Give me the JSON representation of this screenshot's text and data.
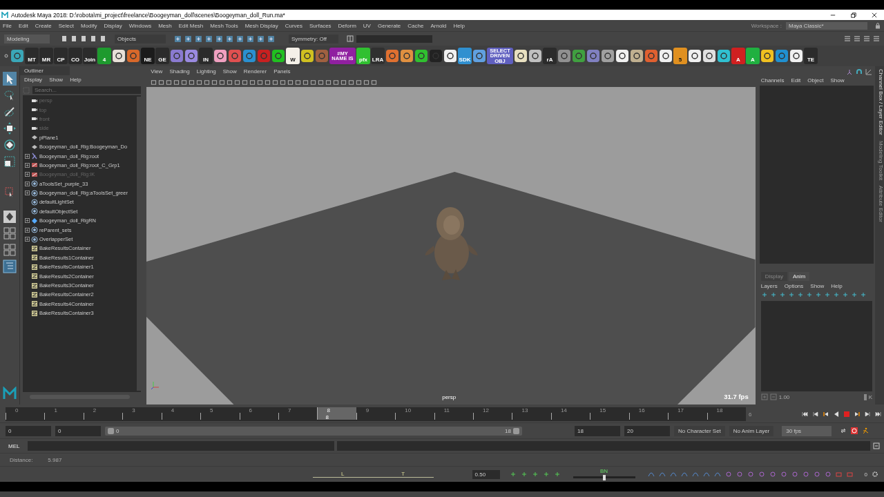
{
  "window": {
    "title": "Autodesk Maya 2018: D:\\robota\\mi_project\\freelance\\Boogeyman_doll\\scenes\\Boogeyman_doll_Run.ma*"
  },
  "menu": [
    "File",
    "Edit",
    "Create",
    "Select",
    "Modify",
    "Display",
    "Windows",
    "Mesh",
    "Edit Mesh",
    "Mesh Tools",
    "Mesh Display",
    "Curves",
    "Surfaces",
    "Deform",
    "UV",
    "Generate",
    "Cache",
    "Arnold",
    "Help"
  ],
  "workspace": {
    "label": "Workspace :",
    "value": "Maya Classic*"
  },
  "status_line": {
    "mode": "Modeling",
    "selection": "Objects",
    "symmetry": "Symmetry: Off"
  },
  "shelf": [
    {
      "color": "#3aa7b8"
    },
    {
      "label": "MT",
      "color": "#2b2b2b"
    },
    {
      "label": "MR",
      "color": "#2b2b2b"
    },
    {
      "label": "CP",
      "color": "#2b2b2b"
    },
    {
      "label": "CO",
      "color": "#2b2b2b"
    },
    {
      "label": "Join",
      "color": "#2b2b2b"
    },
    {
      "label": "4",
      "color": "#1e9a2e"
    },
    {
      "color": "#e8e0d8"
    },
    {
      "color": "#d8682a"
    },
    {
      "label": "NE",
      "color": "#1b1b1b"
    },
    {
      "label": "GE",
      "color": "#2b2b2b"
    },
    {
      "color": "#8a7ad0"
    },
    {
      "color": "#9a8ae0"
    },
    {
      "label": "IN",
      "color": "#2b2b2b"
    },
    {
      "color": "#f0a0c0"
    },
    {
      "color": "#e05050"
    },
    {
      "color": "#2a90d0"
    },
    {
      "color": "#c82020"
    },
    {
      "color": "#20c020"
    },
    {
      "label": "W",
      "color": "#f4f0e8"
    },
    {
      "color": "#d0c020"
    },
    {
      "color": "#a06040"
    },
    {
      "label": "#MY NAME IS",
      "color": "#9020a0"
    },
    {
      "label": "pfx",
      "color": "#30c030"
    },
    {
      "label": "LRA",
      "color": "#303030"
    },
    {
      "color": "#e07030"
    },
    {
      "color": "#e09040"
    },
    {
      "color": "#30c030"
    },
    {
      "color": "#222222"
    },
    {
      "color": "#f0f0f0"
    },
    {
      "label": "SDK",
      "color": "#3090d0"
    },
    {
      "color": "#60a0e0"
    },
    {
      "label": "SELECT DRIVEN OBJ",
      "color": "#6060c0"
    },
    {
      "color": "#e8e0c0"
    },
    {
      "color": "#c0c0c0"
    },
    {
      "label": "rA",
      "color": "#2b2b2b"
    },
    {
      "color": "#909090"
    },
    {
      "color": "#40a040"
    },
    {
      "color": "#8080c0"
    },
    {
      "color": "#a0a0a0"
    },
    {
      "color": "#f0f0f0"
    },
    {
      "color": "#c0b090"
    },
    {
      "color": "#e06030"
    },
    {
      "color": "#f0f0f0"
    },
    {
      "label": "5",
      "color": "#e09020"
    },
    {
      "color": "#f0f0f0"
    },
    {
      "color": "#e0e0e0"
    },
    {
      "color": "#30c0d0"
    },
    {
      "label": "A",
      "color": "#d02020"
    },
    {
      "label": "A",
      "color": "#20b040"
    },
    {
      "color": "#f0c020"
    },
    {
      "color": "#2090d0"
    },
    {
      "color": "#f0f0f0"
    },
    {
      "label": "TE",
      "color": "#2b2b2b"
    }
  ],
  "outliner": {
    "title": "Outliner",
    "menu": [
      "Display",
      "Show",
      "Help"
    ],
    "search": {
      "placeholder": "Search..."
    },
    "items": [
      {
        "kind": "camera",
        "label": "persp",
        "dimmed": true,
        "expandable": false
      },
      {
        "kind": "camera",
        "label": "top",
        "dimmed": true,
        "expandable": false
      },
      {
        "kind": "camera",
        "label": "front",
        "dimmed": true,
        "expandable": false
      },
      {
        "kind": "camera",
        "label": "side",
        "dimmed": true,
        "expandable": false
      },
      {
        "kind": "mesh",
        "label": "pPlane1",
        "dimmed": false,
        "expandable": false
      },
      {
        "kind": "mesh",
        "label": "Boogeyman_doll_Rig:Boogeyman_Do",
        "dimmed": false,
        "expandable": false
      },
      {
        "kind": "joint",
        "label": "Boogeyman_doll_Rig:root",
        "dimmed": false,
        "expandable": true
      },
      {
        "kind": "group",
        "label": "Boogeyman_doll_Rig:root_C_Grp1",
        "dimmed": false,
        "expandable": true
      },
      {
        "kind": "group",
        "label": "Boogeyman_doll_Rig:IK",
        "dimmed": true,
        "expandable": true
      },
      {
        "kind": "set",
        "label": "aToolsSet_purple_33",
        "dimmed": false,
        "expandable": true
      },
      {
        "kind": "set",
        "label": "Boogeyman_doll_Rig:aToolsSet_greer",
        "dimmed": false,
        "expandable": true
      },
      {
        "kind": "set",
        "label": "defaultLightSet",
        "dimmed": false,
        "expandable": false
      },
      {
        "kind": "set",
        "label": "defaultObjectSet",
        "dimmed": false,
        "expandable": false
      },
      {
        "kind": "reference",
        "label": "Boogeyman_doll_RigRN",
        "dimmed": false,
        "expandable": true
      },
      {
        "kind": "set",
        "label": "reParent_sets",
        "dimmed": false,
        "expandable": true
      },
      {
        "kind": "set",
        "label": "OverlapperSet",
        "dimmed": false,
        "expandable": true
      },
      {
        "kind": "container",
        "label": "BakeResultsContainer",
        "dimmed": false,
        "expandable": false
      },
      {
        "kind": "container",
        "label": "BakeResults1Container",
        "dimmed": false,
        "expandable": false
      },
      {
        "kind": "container",
        "label": "BakeResultsContainer1",
        "dimmed": false,
        "expandable": false
      },
      {
        "kind": "container",
        "label": "BakeResults2Container",
        "dimmed": false,
        "expandable": false
      },
      {
        "kind": "container",
        "label": "BakeResults3Container",
        "dimmed": false,
        "expandable": false
      },
      {
        "kind": "container",
        "label": "BakeResultsContainer2",
        "dimmed": false,
        "expandable": false
      },
      {
        "kind": "container",
        "label": "BakeResults4Container",
        "dimmed": false,
        "expandable": false
      },
      {
        "kind": "container",
        "label": "BakeResultsContainer3",
        "dimmed": false,
        "expandable": false
      }
    ]
  },
  "viewport": {
    "menu": [
      "View",
      "Shading",
      "Lighting",
      "Show",
      "Renderer",
      "Panels"
    ],
    "camera": "persp",
    "fps": "31.7 fps"
  },
  "channel_box": {
    "menu": [
      "Channels",
      "Edit",
      "Object",
      "Show"
    ]
  },
  "layer_editor": {
    "tabs": [
      {
        "label": "Display",
        "selected": false
      },
      {
        "label": "Anim",
        "selected": true
      }
    ],
    "menu": [
      "Layers",
      "Options",
      "Show",
      "Help"
    ],
    "weight": "1.00",
    "weight_slider": {
      "level": 1
    },
    "key_label": "K"
  },
  "side_tabs": [
    "Channel Box / Layer Editor",
    "Modeling Toolkit",
    "Attribute Editor"
  ],
  "timeline": {
    "frames": [
      {
        "label": "0",
        "selected": false
      },
      {
        "label": "1",
        "selected": false
      },
      {
        "label": "2",
        "selected": false
      },
      {
        "label": "3",
        "selected": false
      },
      {
        "label": "4",
        "selected": false
      },
      {
        "label": "5",
        "selected": false
      },
      {
        "label": "6",
        "selected": false
      },
      {
        "label": "7",
        "selected": false
      },
      {
        "label": "8",
        "selected": true
      },
      {
        "label": "9",
        "selected": false
      },
      {
        "label": "10",
        "selected": false
      },
      {
        "label": "11",
        "selected": false
      },
      {
        "label": "12",
        "selected": false
      },
      {
        "label": "13",
        "selected": false
      },
      {
        "label": "14",
        "selected": false
      },
      {
        "label": "15",
        "selected": false
      },
      {
        "label": "16",
        "selected": false
      },
      {
        "label": "17",
        "selected": false
      },
      {
        "label": "18",
        "selected": false
      }
    ],
    "current_frame": "8",
    "trailing_label": "6"
  },
  "range": {
    "scene_start": "0",
    "playback_start": "0",
    "slider_start": "0",
    "slider_end": "18",
    "level": 1,
    "playback_end": "18",
    "scene_end": "20",
    "character_set": "No Character Set",
    "anim_layer": "No Anim Layer",
    "fps": "30 fps"
  },
  "command_line": {
    "language": "MEL"
  },
  "help_line": {
    "label": "Distance:",
    "value": "5.987"
  },
  "bottom_bar": {
    "tick_labels": [
      "L",
      "T"
    ],
    "value": "0.50",
    "slider_label": "BN",
    "slider": {
      "level": 0.5
    },
    "count": "0"
  }
}
